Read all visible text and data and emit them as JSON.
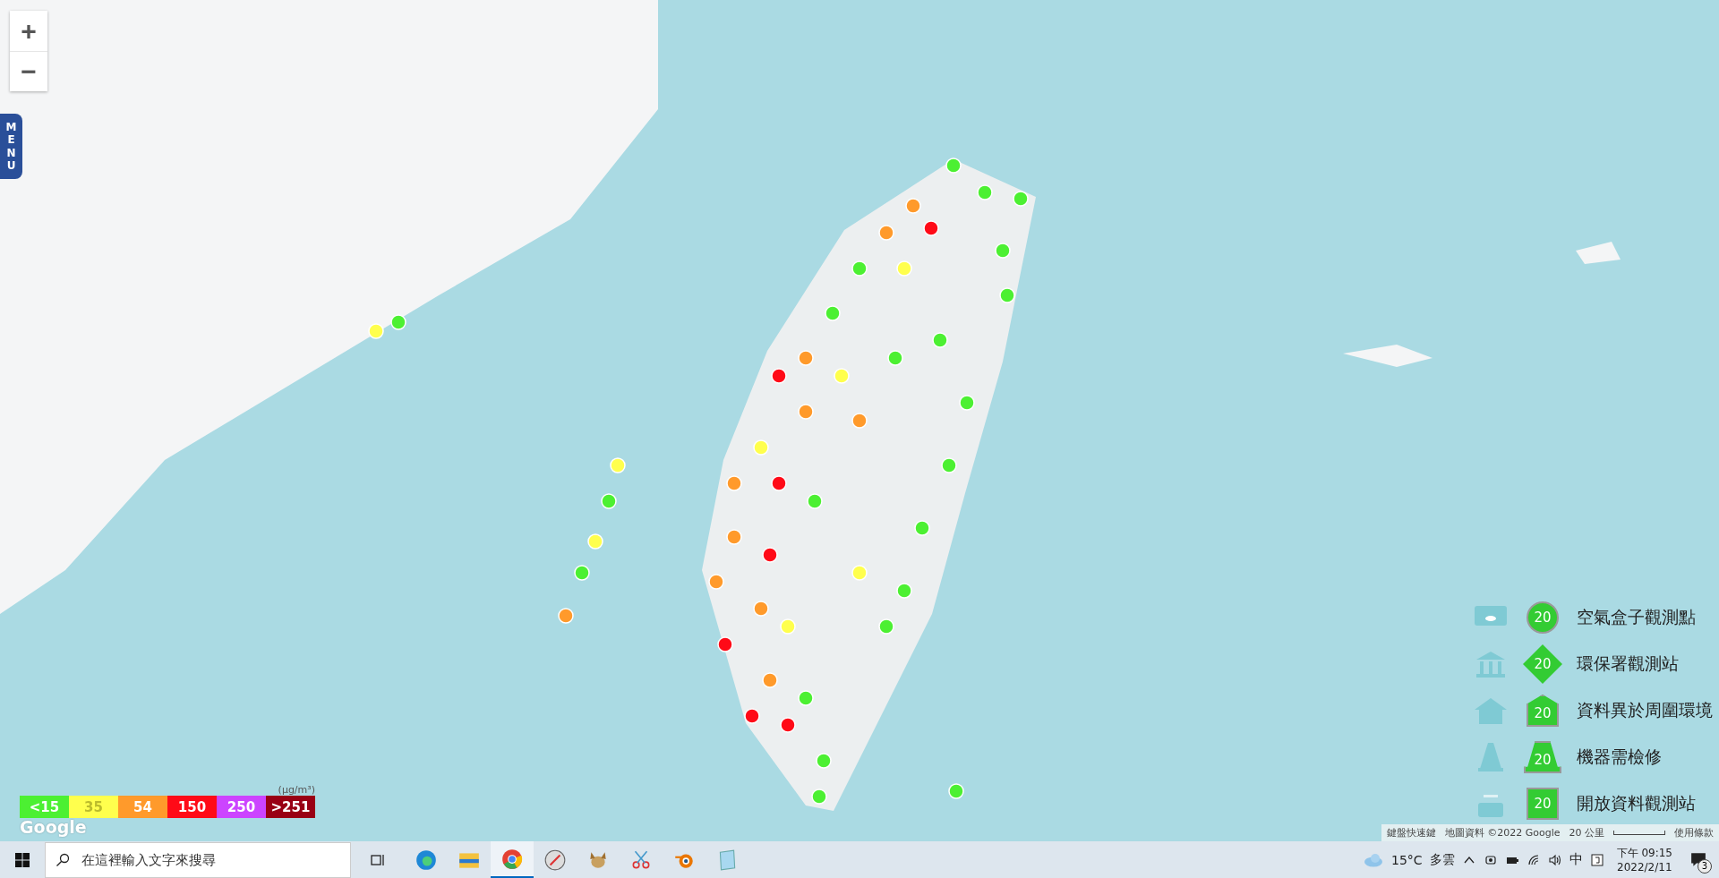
{
  "map_controls": {
    "zoom_in": "+",
    "zoom_out": "−",
    "menu_tab": "MENU"
  },
  "legend": [
    {
      "kind": "circle",
      "value": "20",
      "label": "空氣盒子觀測點"
    },
    {
      "kind": "diamond",
      "value": "20",
      "label": "環保署觀測站"
    },
    {
      "kind": "house",
      "value": "20",
      "label": "資料異於周圍環境"
    },
    {
      "kind": "cone",
      "value": "20",
      "label": "機器需檢修"
    },
    {
      "kind": "square",
      "value": "20",
      "label": "開放資料觀測站"
    }
  ],
  "color_scale": {
    "unit": "(μg/m³)",
    "steps": [
      {
        "label": "<15",
        "color": "#4cf032"
      },
      {
        "label": "35",
        "color": "#ffff4d"
      },
      {
        "label": "54",
        "color": "#ff9a2b"
      },
      {
        "label": "150",
        "color": "#ff0a17"
      },
      {
        "label": "250",
        "color": "#cc44ff"
      },
      {
        "label": ">251",
        "color": "#990014"
      }
    ]
  },
  "google_logo": "Google",
  "attribution": {
    "shortcuts": "鍵盤快速鍵",
    "map_data": "地圖資料 ©2022 Google",
    "scale": "20 公里",
    "terms": "使用條款"
  },
  "taskbar": {
    "search": {
      "placeholder": "在這裡輸入文字來搜尋"
    },
    "apps": [
      {
        "kind": "edge",
        "selected": false
      },
      {
        "kind": "folder",
        "selected": false
      },
      {
        "kind": "chrome",
        "selected": true
      },
      {
        "kind": "compass",
        "selected": false
      },
      {
        "kind": "fox",
        "selected": false
      },
      {
        "kind": "scissors",
        "selected": false
      },
      {
        "kind": "blender",
        "selected": false
      },
      {
        "kind": "notepad",
        "selected": false
      }
    ],
    "weather": {
      "temp": "15°C",
      "condition": "多雲"
    },
    "ime": "中",
    "clock": {
      "time": "下午 09:15",
      "date": "2022/2/11"
    },
    "notifications": "3"
  }
}
